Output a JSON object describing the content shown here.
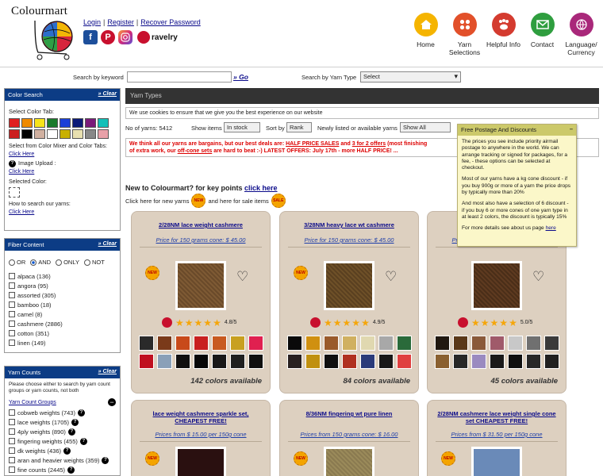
{
  "brand": "Colourmart",
  "auth": {
    "login": "Login",
    "register": "Register",
    "recover": "Recover Password"
  },
  "social": {
    "ravelry": "ravelry"
  },
  "nav": [
    {
      "label": "Home",
      "icon": "home-icon",
      "color": "#f5b400"
    },
    {
      "label": "Yarn Selections",
      "icon": "grid-icon",
      "color": "#e2502a"
    },
    {
      "label": "Helpful Info",
      "icon": "paw-icon",
      "color": "#d43b2f"
    },
    {
      "label": "Contact",
      "icon": "mail-icon",
      "color": "#2f9e3f"
    },
    {
      "label": "Language/ Currency",
      "icon": "globe-icon",
      "color": "#a9287a"
    }
  ],
  "search": {
    "keyword_label": "Search by keyword",
    "keyword_value": "",
    "go_label": "» Go",
    "yarn_type_label": "Search by Yarn Type",
    "yarn_type_value": "Select"
  },
  "color_search": {
    "title": "Color Search",
    "clear": "» Clear",
    "tab_label": "Select Color Tab:",
    "swatches": [
      "#e02020",
      "#f08a00",
      "#f7e41a",
      "#1a7a2a",
      "#1a3fd8",
      "#0b1a78",
      "#7a1a7a",
      "#12c0b8",
      "#cc2020",
      "#000000",
      "#d0b0a0",
      "#ffffff",
      "#c8b000",
      "#e8e0b0",
      "#888888",
      "#e8a0a8"
    ],
    "mixer_label": "Select from Color Mixer and Color Tabs:",
    "mixer_link": "Click Here",
    "upload_label": "Image Upload :",
    "upload_link": "Click Here",
    "selected_label": "Selected Color:",
    "howto_label": "How to search our yarns:",
    "howto_link": "Click Here"
  },
  "fiber": {
    "title": "Fiber Content",
    "clear": "» Clear",
    "modes": [
      {
        "label": "OR",
        "checked": false
      },
      {
        "label": "AND",
        "checked": true
      },
      {
        "label": "ONLY",
        "checked": false
      },
      {
        "label": "NOT",
        "checked": false
      }
    ],
    "items": [
      "alpaca (136)",
      "angora (95)",
      "assorted (305)",
      "bamboo (18)",
      "camel (8)",
      "cashmere (2886)",
      "cotton (351)",
      "linen (149)"
    ]
  },
  "counts": {
    "title": "Yarn Counts",
    "clear": "» Clear",
    "note": "Please choose either to search by yarn count groups or yarn counts, not both",
    "group_title": "Yarn Count Groups",
    "items": [
      "cobweb weights (743)",
      "lace weights (1705)",
      "4ply weights (890)",
      "fingering weights (455)",
      "dk weights (436)",
      "aran and heavier weights (359)",
      "fine counts (2445)"
    ]
  },
  "main": {
    "section_title": "Yarn Types",
    "cookie": "We use cookies to ensure that we give you the best experience on our website",
    "no_yarns_label": "No of yarns: 5412",
    "show_items_label": "Show items",
    "show_items_value": "In stock",
    "sort_label": "Sort by",
    "sort_value": "Rank",
    "newly_label": "Newly listed or available yarns",
    "newly_value": "Show All",
    "deals_1": "We think all our yarns are bargains, but our best deals are: ",
    "deals_half": "HALF PRICE SALES",
    "deals_and": " and ",
    "deals_offers": "3 for 2 offers",
    "deals_2": " (most finishing",
    "deals_3": "of extra work, our ",
    "deals_offcone": "off-cone sets",
    "deals_4": " are hard to beat :-)  LATEST OFFERS: July 17th - more HALF PRICE! ...",
    "new_text": "New to Colourmart? for key points ",
    "new_link": "click here",
    "new_yarns_text": "Click here for new yarns",
    "sale_text": "and here for sale items",
    "badge_new": "NEW",
    "badge_sale": "SALE"
  },
  "products": [
    {
      "title": "2/28NM lace weight cashmere",
      "price": "Price for 150 grams cone: $ 45.00",
      "photo_color": "#6a4a2a",
      "score": "4.8/5",
      "count": "142 colors available",
      "chips": [
        "#2a2a2a",
        "#7a3a1a",
        "#c84a1a",
        "#c82020",
        "#c85a20",
        "#c8a020",
        "#e02050",
        "#c01020",
        "#8aa0b8",
        "#101010",
        "#080808",
        "#181818",
        "#202020",
        "#101010"
      ]
    },
    {
      "title": "3/28NM heavy lace wt cashmere",
      "price": "Price for 150 grams cone: $ 45.00",
      "photo_color": "#5a4020",
      "score": "4.9/5",
      "count": "84 colors available",
      "chips": [
        "#0a0a0a",
        "#d09010",
        "#9a5a2a",
        "#d0b060",
        "#e0d8b0",
        "#a8a8a8",
        "#2a6a3a",
        "#282020",
        "#c09010",
        "#101010",
        "#b03020",
        "#2a3a7a",
        "#181818",
        "#e04040"
      ]
    },
    {
      "title": "5/28NM ... cashmere",
      "price": "Price for 150 grams cone: $ 48.00",
      "photo_color": "#4a2e18",
      "score": "5.0/5",
      "count": "45 colors available",
      "chips": [
        "#201810",
        "#5a3818",
        "#8a5a3a",
        "#a05a6a",
        "#c8c8c8",
        "#707070",
        "#3a3a3a",
        "#8a6030",
        "#282828",
        "#9a8ac0",
        "#1a1a1a",
        "#101010",
        "#282828",
        "#202020"
      ]
    },
    {
      "title": "lace weight cashmere sparkle set, CHEAPEST FREE!",
      "price": "Prices from $ 15.00 per 150g cone",
      "photo_color": "#2a1010"
    },
    {
      "title": "8/36NM fingering wt pure linen",
      "price": "Prices from 150 grams cone: $ 16.00",
      "photo_color": "#8a7a50"
    },
    {
      "title": "2/28NM cashmere lace weight single cone set CHEAPEST FREE!",
      "price": "Prices from $ 31.50 per 150g cone",
      "photo_color": "#6a8ab8"
    }
  ],
  "popup": {
    "title": "Free Postage And Discounts",
    "p1": "The prices you see include priority airmail postage to anywhere in the world. We can arrange tracking or signed for packages, for a fee, - these options can be selected at checkout.",
    "p2": "Most of our yarns have a kg cone discount - if you buy 900g or more of a yarn the price drops by typically more than 20%",
    "p3": "And most also have a selection of 6 discount - if you buy 6 or more cones of one yarn type in at least 2 colors, the discount is typically 15%",
    "p4_text": "For more details see about us page ",
    "p4_link": "here"
  }
}
